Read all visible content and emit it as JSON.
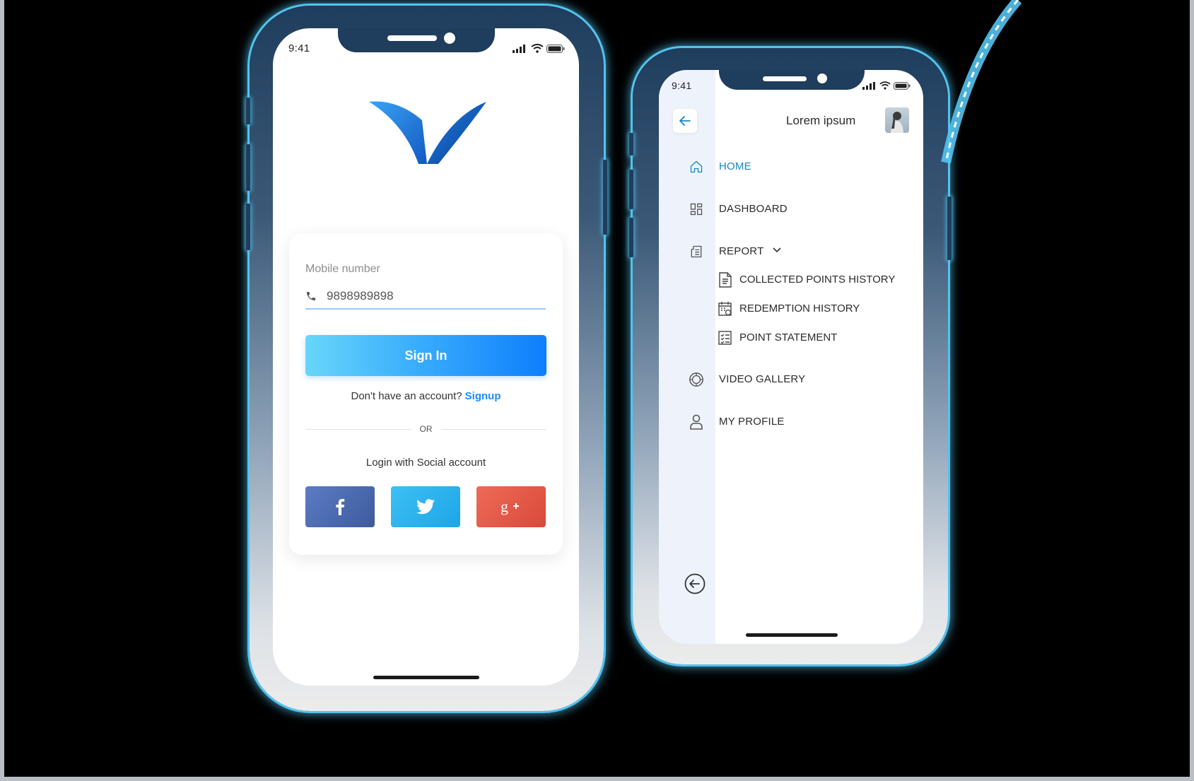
{
  "status_bar": {
    "time": "9:41"
  },
  "login": {
    "field_label": "Mobile number",
    "mobile_value": "9898989898",
    "signin_label": "Sign In",
    "no_account_text": "Don't have an account?",
    "signup_label": "Signup",
    "or_text": "OR",
    "social_label": "Login with Social account",
    "social_buttons": [
      {
        "name": "facebook",
        "icon": "facebook-icon",
        "color": "#4f6bb0"
      },
      {
        "name": "twitter",
        "icon": "twitter-icon",
        "color": "#2bb2ee"
      },
      {
        "name": "google-plus",
        "icon": "google-plus-icon",
        "color": "#e35a47"
      }
    ]
  },
  "menu": {
    "profile_name": "Lorem ipsum",
    "items": [
      {
        "label": "HOME",
        "icon": "home-icon",
        "active": true
      },
      {
        "label": "DASHBOARD",
        "icon": "dashboard-icon"
      },
      {
        "label": "REPORT",
        "icon": "report-icon",
        "expanded": true
      },
      {
        "label": "VIDEO GALLERY",
        "icon": "video-gallery-icon"
      },
      {
        "label": "MY PROFILE",
        "icon": "user-icon"
      }
    ],
    "report_subitems": [
      {
        "label": "COLLECTED POINTS HISTORY",
        "icon": "document-icon"
      },
      {
        "label": "REDEMPTION HISTORY",
        "icon": "calendar-icon"
      },
      {
        "label": "POINT STATEMENT",
        "icon": "checklist-icon"
      }
    ]
  },
  "colors": {
    "accent": "#1a8cff",
    "active_menu": "#1a86c8",
    "phone_frame": "#1f3d5c",
    "glow": "#53c3f0"
  }
}
